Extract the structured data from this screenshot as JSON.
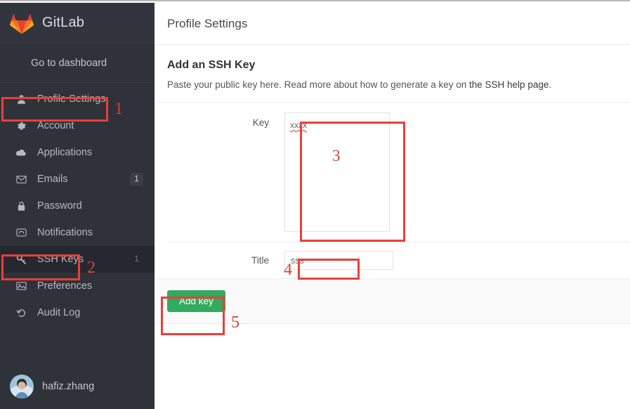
{
  "brand": {
    "name": "GitLab",
    "logo_icon": "gitlab-tanuki-icon",
    "logo_color": "#e8622c"
  },
  "sidebar": {
    "dashboard_link": "Go to dashboard",
    "items": [
      {
        "label": "Profile Settings",
        "icon": "user-icon",
        "badge": "",
        "active": false
      },
      {
        "label": "Account",
        "icon": "gear-icon",
        "badge": "",
        "active": false
      },
      {
        "label": "Applications",
        "icon": "cloud-icon",
        "badge": "",
        "active": false
      },
      {
        "label": "Emails",
        "icon": "envelope-icon",
        "badge": "1",
        "active": false
      },
      {
        "label": "Password",
        "icon": "lock-icon",
        "badge": "",
        "active": false
      },
      {
        "label": "Notifications",
        "icon": "inbox-icon",
        "badge": "",
        "active": false
      },
      {
        "label": "SSH Keys",
        "icon": "key-icon",
        "badge": "1",
        "active": true
      },
      {
        "label": "Preferences",
        "icon": "image-icon",
        "badge": "",
        "active": false
      },
      {
        "label": "Audit Log",
        "icon": "history-icon",
        "badge": "",
        "active": false
      }
    ],
    "user": {
      "name": "hafiz.zhang",
      "avatar_icon": "avatar-photo"
    }
  },
  "header": {
    "title": "Profile Settings"
  },
  "main": {
    "section_title": "Add an SSH Key",
    "description_before": "Paste your public key here. Read more about how to generate a key on ",
    "description_link": "the SSH help page",
    "description_after": ".",
    "form": {
      "key_label": "Key",
      "key_value": "xxxx",
      "key_placeholder": "",
      "title_label": "Title",
      "title_value": "sss",
      "title_placeholder": "",
      "submit_label": "Add key",
      "submit_color": "#31ab5e"
    }
  },
  "annotations": {
    "color": "#e8403a",
    "markers": [
      {
        "number": "1",
        "target": "sidebar-item-profile-settings"
      },
      {
        "number": "2",
        "target": "sidebar-item-ssh-keys"
      },
      {
        "number": "3",
        "target": "key-textarea"
      },
      {
        "number": "4",
        "target": "title-input"
      },
      {
        "number": "5",
        "target": "add-key-button"
      }
    ]
  }
}
